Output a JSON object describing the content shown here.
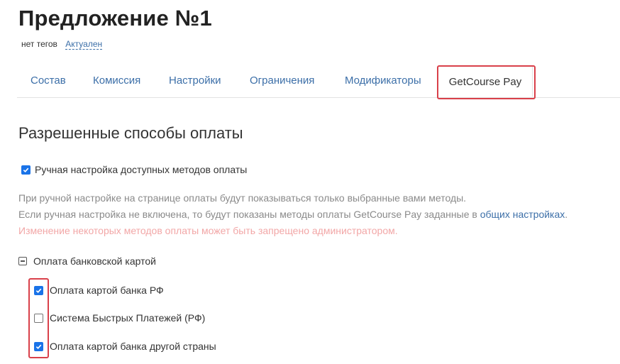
{
  "header": {
    "title": "Предложение №1",
    "no_tags": "нет тегов",
    "status": "Актуален"
  },
  "tabs": [
    {
      "label": "Состав"
    },
    {
      "label": "Комиссия"
    },
    {
      "label": "Настройки"
    },
    {
      "label": "Ограничения"
    },
    {
      "label": "Модификаторы"
    },
    {
      "label": "GetCourse Pay",
      "active": true
    }
  ],
  "section": {
    "title": "Разрешенные способы оплаты",
    "manual_checkbox": {
      "label": "Ручная настройка доступных методов оплаты",
      "checked": true
    },
    "help_line1": "При ручной настройке на странице оплаты будут показываться только выбранные вами методы.",
    "help_line2_prefix": "Если ручная настройка не включена, то будут показаны методы оплаты GetCourse Pay заданные в ",
    "help_line2_link": "общих настройках",
    "help_line2_suffix": ".",
    "warning": "Изменение некоторых методов оплаты может быть запрещено администратором."
  },
  "payment_group": {
    "label": "Оплата банковской картой",
    "methods": [
      {
        "label": "Оплата картой банка РФ",
        "checked": true
      },
      {
        "label": "Система Быстрых Платежей (РФ)",
        "checked": false
      },
      {
        "label": "Оплата картой банка другой страны",
        "checked": true
      }
    ]
  },
  "colors": {
    "link": "#3c6fa8",
    "checkbox": "#1a73e8",
    "highlight": "#d9404a",
    "warning": "#f2a7a7"
  }
}
